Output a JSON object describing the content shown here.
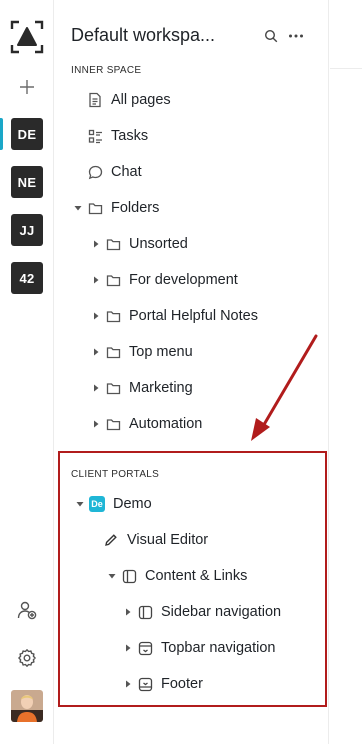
{
  "rail": {
    "workspaces": [
      {
        "initials": "DE",
        "active": true
      },
      {
        "initials": "NE",
        "active": false
      },
      {
        "initials": "JJ",
        "active": false
      },
      {
        "initials": "42",
        "active": false
      }
    ],
    "accent_color": "#1aa7c8",
    "icons": [
      "logo-icon",
      "plus-icon",
      "add-user-icon",
      "settings-icon"
    ]
  },
  "sidebar": {
    "workspace_title": "Default workspa...",
    "inner_space": {
      "label": "INNER SPACE",
      "items": [
        {
          "label": "All pages",
          "icon": "page-icon"
        },
        {
          "label": "Tasks",
          "icon": "tasks-icon"
        },
        {
          "label": "Chat",
          "icon": "chat-icon"
        }
      ],
      "folders": {
        "label": "Folders",
        "expanded": true,
        "children": [
          {
            "label": "Unsorted"
          },
          {
            "label": "For development"
          },
          {
            "label": "Portal Helpful Notes"
          },
          {
            "label": "Top menu"
          },
          {
            "label": "Marketing"
          },
          {
            "label": "Automation"
          }
        ]
      }
    },
    "client_portals": {
      "label": "CLIENT PORTALS",
      "portal": {
        "name": "Demo",
        "chip": "De",
        "chip_color": "#1fb6d6",
        "items": [
          {
            "label": "Visual Editor",
            "icon": "pencil-icon"
          },
          {
            "label": "Content & Links",
            "icon": "sidebar-layout-icon"
          }
        ],
        "content_children": [
          {
            "label": "Sidebar navigation",
            "icon": "sidebar-layout-icon"
          },
          {
            "label": "Topbar navigation",
            "icon": "topbar-layout-icon"
          },
          {
            "label": "Footer",
            "icon": "footer-layout-icon"
          }
        ]
      }
    },
    "annotation_color": "#b11c1c"
  }
}
